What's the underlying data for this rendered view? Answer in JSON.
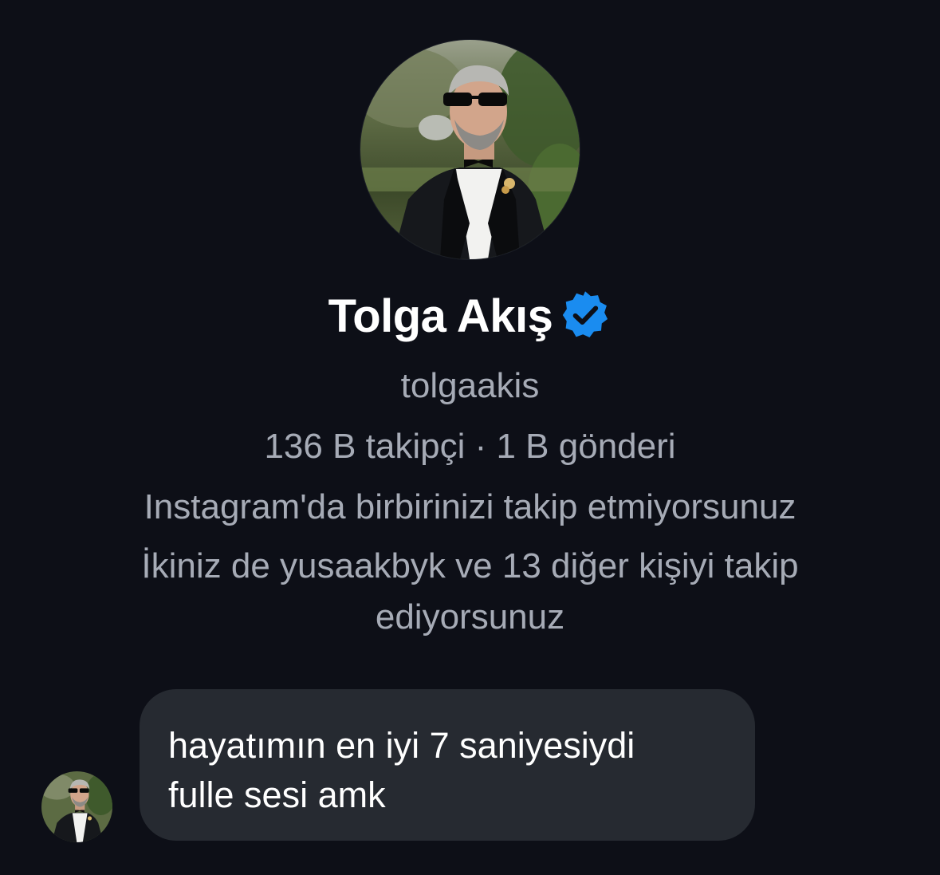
{
  "profile": {
    "display_name": "Tolga Akış",
    "verified_icon": "verified-badge-icon",
    "username": "tolgaakis",
    "stats": "136 B takipçi · 1 B gönderi",
    "follow_status": "Instagram'da birbirinizi takip etmiyorsunuz",
    "mutual_line_1": "İkiniz de yusaakbyk ve 13 diğer kişiyi takip",
    "mutual_line_2": "ediyorsunuz"
  },
  "message": {
    "line_1": "hayatımın en iyi 7 saniyesiydi",
    "line_2": "fulle sesi amk"
  },
  "colors": {
    "background": "#0d0f17",
    "secondary_text": "#a6abb6",
    "bubble": "#262a31",
    "verified_blue": "#1a8cf0"
  }
}
